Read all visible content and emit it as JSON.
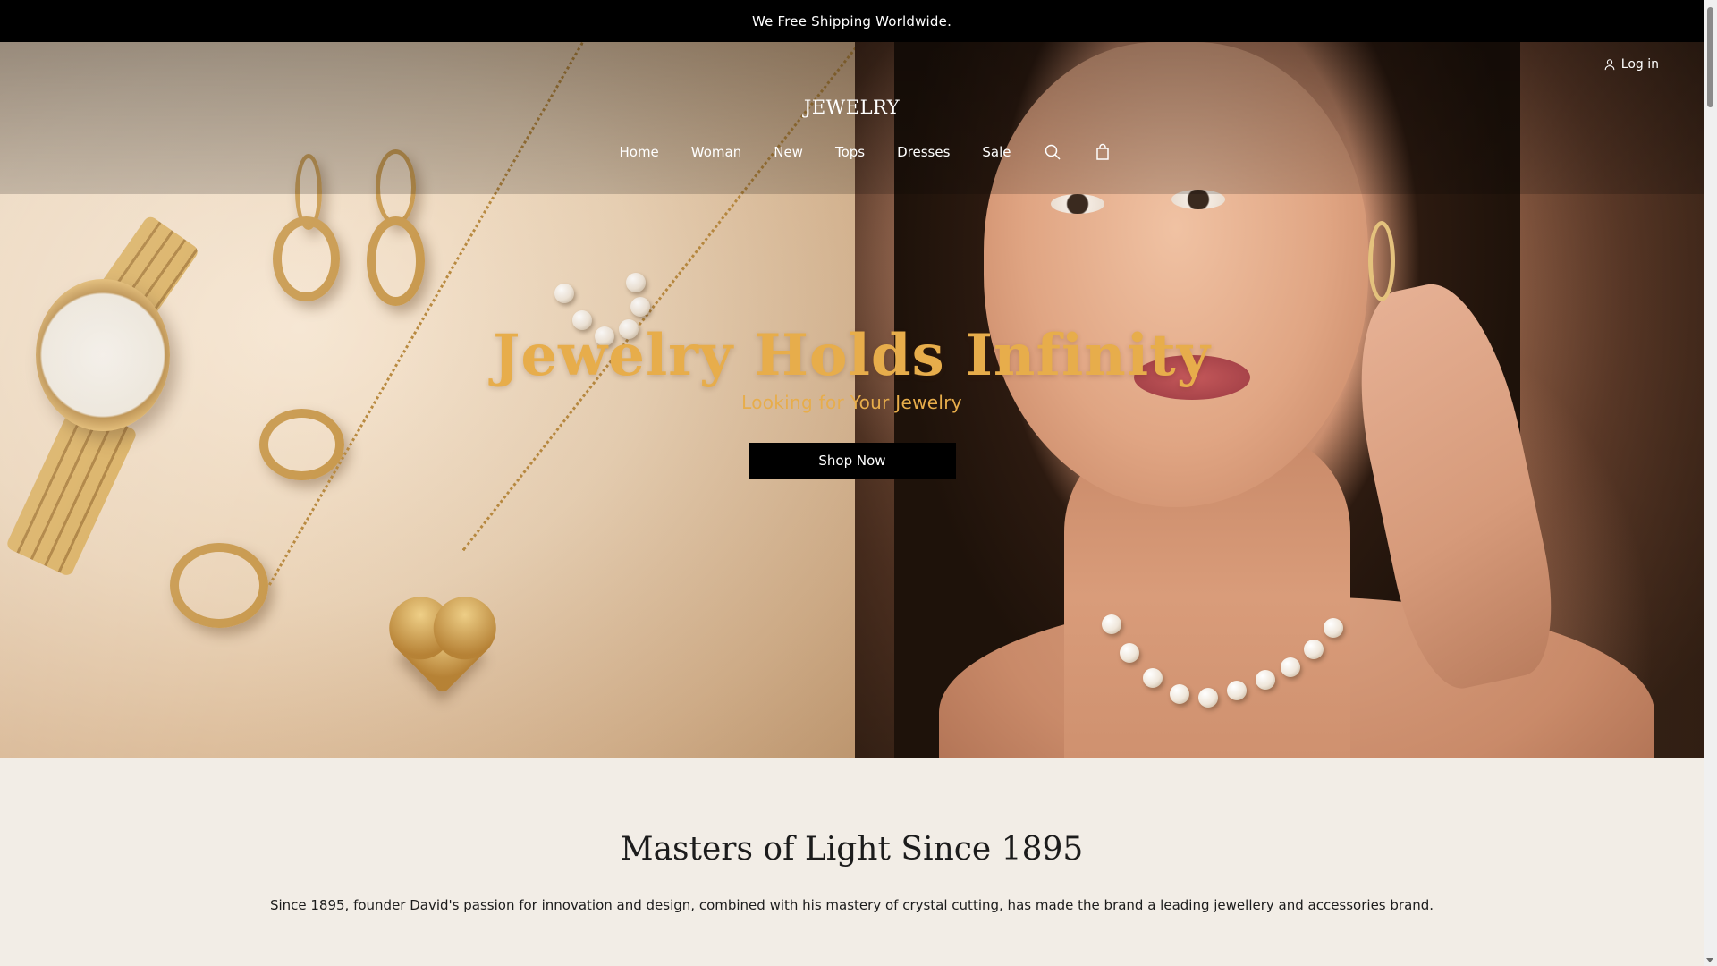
{
  "announcement": {
    "text": "We Free Shipping Worldwide."
  },
  "header": {
    "login_label": "Log in",
    "logo": "JEWELRY",
    "nav": [
      "Home",
      "Woman",
      "New",
      "Tops",
      "Dresses",
      "Sale"
    ],
    "search_icon": "search-icon",
    "cart_icon": "shopping-bag-icon"
  },
  "hero": {
    "title": "Jewelry Holds Infinity",
    "subtitle": "Looking for Your Jewelry",
    "cta_label": "Shop Now",
    "slides": 2,
    "active_slide": 1,
    "accent_color": "#e7ad4b"
  },
  "about": {
    "heading": "Masters of Light Since 1895",
    "body": "Since 1895, founder David's passion for innovation and design, combined with his mastery of crystal cutting, has made the brand a leading jewellery and accessories brand."
  }
}
